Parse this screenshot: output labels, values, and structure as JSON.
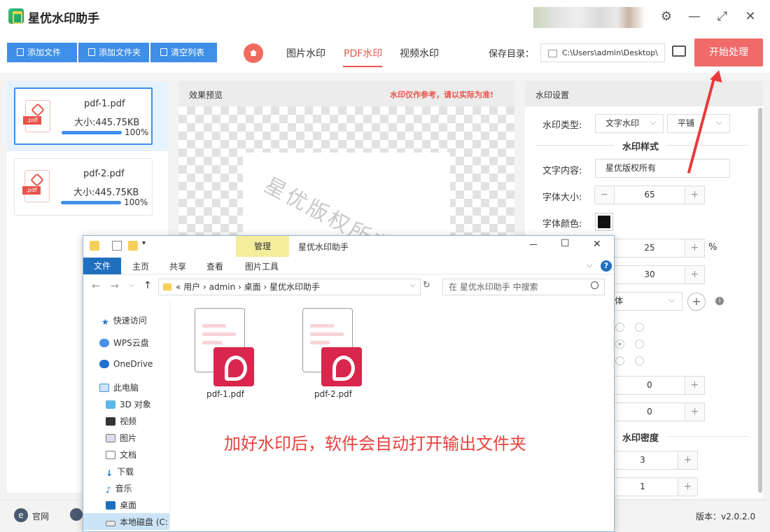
{
  "app": {
    "title": "星优水印助手",
    "version": "版本：v2.0.2.0"
  },
  "window_controls": {
    "settings": "⚙",
    "minimize": "—",
    "maximize": "⤢",
    "close": "✕"
  },
  "toolbar": {
    "add_file": "添加文件",
    "add_folder": "添加文件夹",
    "clear_list": "清空列表"
  },
  "tabs": [
    {
      "label": "图片水印"
    },
    {
      "label": "PDF水印"
    },
    {
      "label": "视频水印"
    }
  ],
  "save_dir": {
    "label": "保存目录：",
    "value": "C:\\Users\\admin\\Desktop\\"
  },
  "start_button": "开始处理",
  "files": [
    {
      "name": "pdf-1.pdf",
      "size": "大小:445.75KB",
      "progress": "100%",
      "badge": ".pdf"
    },
    {
      "name": "pdf-2.pdf",
      "size": "大小:445.75KB",
      "progress": "100%",
      "badge": ".pdf"
    }
  ],
  "preview": {
    "title": "效果预览",
    "warning": "水印仅作参考，请以实际为准!",
    "watermark_text": "星优版权所有"
  },
  "settings": {
    "title": "水印设置",
    "type_label": "水印类型:",
    "type_value": "文字水印",
    "mode_value": "平铺",
    "style_section": "水印样式",
    "text_label": "文字内容:",
    "text_value": "星优版权所有",
    "size_label": "字体大小:",
    "size_value": "65",
    "color_label": "字体颜色:",
    "opacity_value": "25",
    "opacity_unit": "%",
    "rotation_value": "30",
    "font_value": "体",
    "offset_x": "0",
    "offset_y": "0",
    "density_section": "水印密度",
    "density_row": "3",
    "density_col": "1",
    "minus": "−",
    "plus": "+",
    "add": "+",
    "info": "i"
  },
  "statusbar": {
    "website": "官网",
    "website_icon": "e"
  },
  "explorer": {
    "manage_tab": "管理",
    "title": "星优水印助手",
    "ribbon": {
      "file": "文件",
      "home": "主页",
      "share": "共享",
      "view": "查看",
      "picture_tools": "图片工具"
    },
    "address": "«  用户  ›  admin  ›  桌面  ›  星优水印助手",
    "search_placeholder": "在 星优水印助手 中搜索",
    "nav": [
      "快速访问",
      "WPS云盘",
      "OneDrive",
      "此电脑",
      "3D 对象",
      "视频",
      "图片",
      "文档",
      "下载",
      "音乐",
      "桌面",
      "本地磁盘 (C:"
    ],
    "files": [
      "pdf-1.pdf",
      "pdf-2.pdf"
    ],
    "minimize": "—",
    "maximize": "☐",
    "close": "✕",
    "help": "?"
  },
  "notice": "加好水印后，软件会自动打开输出文件夹",
  "colors": {
    "accent_blue": "#3f8fe8",
    "accent_red": "#e8544a",
    "start_button": "#f06a6a",
    "manage_tab": "#f3ed9c"
  }
}
